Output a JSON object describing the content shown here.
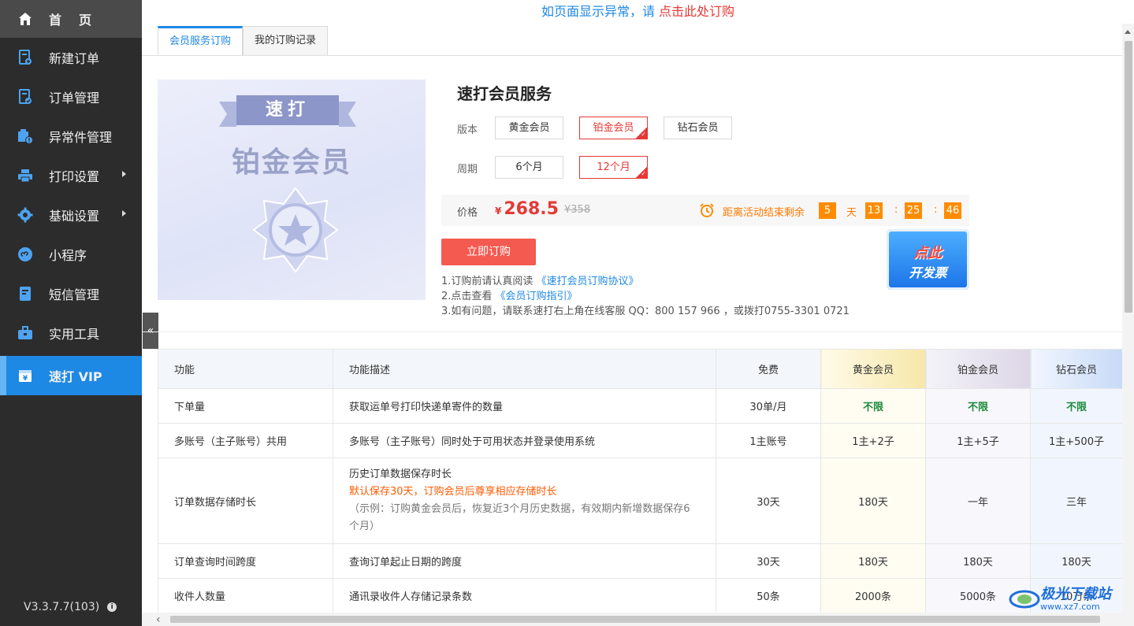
{
  "sidebar": {
    "items": [
      {
        "label": "首页",
        "icon": "home-icon"
      },
      {
        "label": "新建订单",
        "icon": "new-order-icon"
      },
      {
        "label": "订单管理",
        "icon": "order-manage-icon"
      },
      {
        "label": "异常件管理",
        "icon": "exception-icon"
      },
      {
        "label": "打印设置",
        "icon": "printer-icon"
      },
      {
        "label": "基础设置",
        "icon": "gear-icon"
      },
      {
        "label": "小程序",
        "icon": "miniprogram-icon"
      },
      {
        "label": "短信管理",
        "icon": "sms-icon"
      },
      {
        "label": "实用工具",
        "icon": "toolbox-icon"
      },
      {
        "label": "速打 VIP",
        "icon": "vip-icon"
      }
    ],
    "version": "V3.3.7.7(103)"
  },
  "notice": {
    "text": "如页面显示异常，请 ",
    "link": "点击此处订购"
  },
  "tabs": [
    {
      "label": "会员服务订购",
      "active": true
    },
    {
      "label": "我的订购记录",
      "active": false
    }
  ],
  "promo": {
    "ribbon": "速打",
    "title": "铂金会员"
  },
  "product": {
    "title": "速打会员服务",
    "version_label": "版本",
    "versions": [
      "黄金会员",
      "铂金会员",
      "钻石会员"
    ],
    "selected_version": "铂金会员",
    "period_label": "周期",
    "periods": [
      "6个月",
      "12个月"
    ],
    "selected_period": "12个月",
    "price_label": "价格",
    "currency": "¥",
    "price": "268.5",
    "old_price": "¥358",
    "countdown_text": "距离活动结束剩余",
    "countdown": {
      "days": "5",
      "day_unit": "天",
      "hours": "13",
      "minutes": "25",
      "seconds": "46",
      "sep": ":"
    },
    "buy_button": "立即订购",
    "invoice": {
      "line1": "点此",
      "line2": "开发票"
    },
    "notes": {
      "n1_text": "1.订购前请认真阅读 ",
      "n1_link": "《速打会员订购协议》",
      "n2_text": "2.点击查看 ",
      "n2_link": "《会员订购指引》",
      "n3_text": "3.如有问题，请联系速打右上角在线客服 QQ：800 157 966 ，或拨打0755-3301 0721"
    }
  },
  "table": {
    "headers": [
      "功能",
      "功能描述",
      "免费",
      "黄金会员",
      "铂金会员",
      "钻石会员"
    ],
    "rows": [
      {
        "feature": "下单量",
        "desc": "获取运单号打印快递单寄件的数量",
        "free": "30单/月",
        "gold": "不限",
        "plat": "不限",
        "dia": "不限"
      },
      {
        "feature": "多账号（主子账号）共用",
        "desc": "多账号（主子账号）同时处于可用状态并登录使用系统",
        "free": "1主账号",
        "gold": "1主+2子",
        "plat": "1主+5子",
        "dia": "1主+500子"
      },
      {
        "feature": "订单数据存储时长",
        "desc": "历史订单数据保存时长",
        "desc_highlight": "默认保存30天，订购会员后尊享相应存储时长",
        "desc_note": "（示例：订购黄金会员后，恢复近3个月历史数据，有效期内新增数据保存6个月）",
        "free": "30天",
        "gold": "180天",
        "plat": "一年",
        "dia": "三年"
      },
      {
        "feature": "订单查询时间跨度",
        "desc": "查询订单起止日期的跨度",
        "free": "30天",
        "gold": "180天",
        "plat": "180天",
        "dia": "180天"
      },
      {
        "feature": "收件人数量",
        "desc": "通讯录收件人存储记录条数",
        "free": "50条",
        "gold": "2000条",
        "plat": "5000条",
        "dia": "10万条"
      }
    ]
  },
  "watermark": {
    "text": "极光下载站",
    "url": "www.xz7.com"
  },
  "colors": {
    "sidebar_bg": "#2c2c2c",
    "vip_active": "#1e88e5",
    "accent_red": "#e53935",
    "countdown_orange": "#ff8c00",
    "buy_button": "#f45a50"
  }
}
